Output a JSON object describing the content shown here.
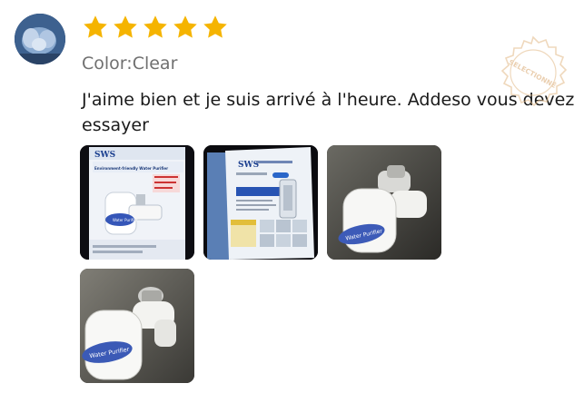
{
  "review": {
    "rating": 5,
    "rating_max": 5,
    "color_label": "Color:",
    "color_value": "Clear",
    "text": "J'aime bien et je suis arrivé à l'heure. Addeso vous devez essayer",
    "stamp_text": "SELECTIONNÉ"
  },
  "photos": [
    {
      "box_brand": "SWS",
      "box_title": "Environment-friendly Water Purifier",
      "filter_label": "Water Purifier"
    },
    {
      "box_brand": "SWS"
    },
    {
      "filter_label": "Water Purifier"
    },
    {
      "filter_label": "Water Purifier"
    }
  ],
  "colors": {
    "star": "#F5B400",
    "muted_text": "#707070",
    "stamp": "#E8C9A0"
  },
  "icons": [
    "star-icon"
  ]
}
